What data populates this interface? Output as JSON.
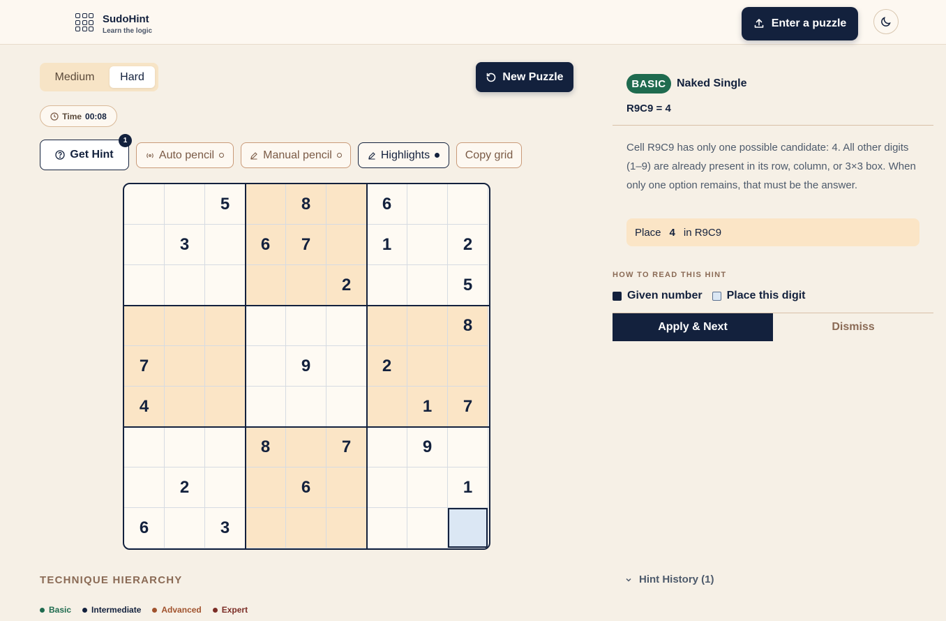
{
  "app": {
    "name": "SudoHint",
    "tagline": "Learn the logic"
  },
  "header": {
    "enter_puzzle_label": "Enter a puzzle",
    "upload_icon": "upload-icon",
    "theme_icon": "moon-icon"
  },
  "difficulty": {
    "options": [
      "Medium",
      "Hard"
    ],
    "selected": "Hard"
  },
  "new_puzzle_label": "New Puzzle",
  "timer": {
    "label": "Time",
    "value": "00:08"
  },
  "toolbar": {
    "get_hint": "Get Hint",
    "hint_badge": "1",
    "auto_pencil": "Auto pencil",
    "manual_pencil": "Manual pencil",
    "highlights": "Highlights",
    "copy_grid": "Copy grid"
  },
  "grid": {
    "cells": [
      [
        "",
        "",
        "5",
        "",
        "8",
        "",
        "6",
        "",
        ""
      ],
      [
        "",
        "3",
        "",
        "6",
        "7",
        "",
        "1",
        "",
        "2"
      ],
      [
        "",
        "",
        "",
        "",
        "",
        "2",
        "",
        "",
        "5"
      ],
      [
        "",
        "",
        "",
        "",
        "",
        "",
        "",
        "",
        "8"
      ],
      [
        "7",
        "",
        "",
        "",
        "9",
        "",
        "2",
        "",
        ""
      ],
      [
        "4",
        "",
        "",
        "",
        "",
        "",
        "",
        "1",
        "7"
      ],
      [
        "",
        "",
        "",
        "8",
        "",
        "7",
        "",
        "9",
        ""
      ],
      [
        "",
        "2",
        "",
        "",
        "6",
        "",
        "",
        "",
        "1"
      ],
      [
        "6",
        "",
        "3",
        "",
        "",
        "",
        "",
        "",
        ""
      ]
    ],
    "shaded_boxes": [
      [
        0,
        1
      ],
      [
        1,
        0
      ],
      [
        1,
        2
      ],
      [
        2,
        1
      ]
    ],
    "target_cell": [
      8,
      8
    ],
    "colors": {
      "shade": "#fbe5c6",
      "target": "#dbe7f4",
      "given": "#13213d"
    }
  },
  "technique_hierarchy": {
    "title": "TECHNIQUE HIERARCHY",
    "levels": [
      {
        "label": "Basic",
        "color": "#1f6b4f"
      },
      {
        "label": "Intermediate",
        "color": "#13213d"
      },
      {
        "label": "Advanced",
        "color": "#a0522d"
      },
      {
        "label": "Expert",
        "color": "#7b2d26"
      }
    ]
  },
  "hint_panel": {
    "level_badge": "BASIC",
    "technique": "Naked Single",
    "cell_equation": "R9C9 = 4",
    "description": "Cell R9C9 has only one possible candidate: 4. All other digits (1–9) are already present in its row, column, or 3×3 box. When only one option remains, that must be the answer.",
    "place": {
      "prefix": "Place",
      "digit": "4",
      "suffix": "in R9C9"
    },
    "how_to_read_title": "HOW TO READ THIS HINT",
    "legend": [
      {
        "label": "Given number",
        "color": "#13213d"
      },
      {
        "label": "Place this digit",
        "color": "#dbe7f4"
      }
    ],
    "apply_label": "Apply & Next",
    "dismiss_label": "Dismiss"
  },
  "hint_history": "Hint History (1)"
}
